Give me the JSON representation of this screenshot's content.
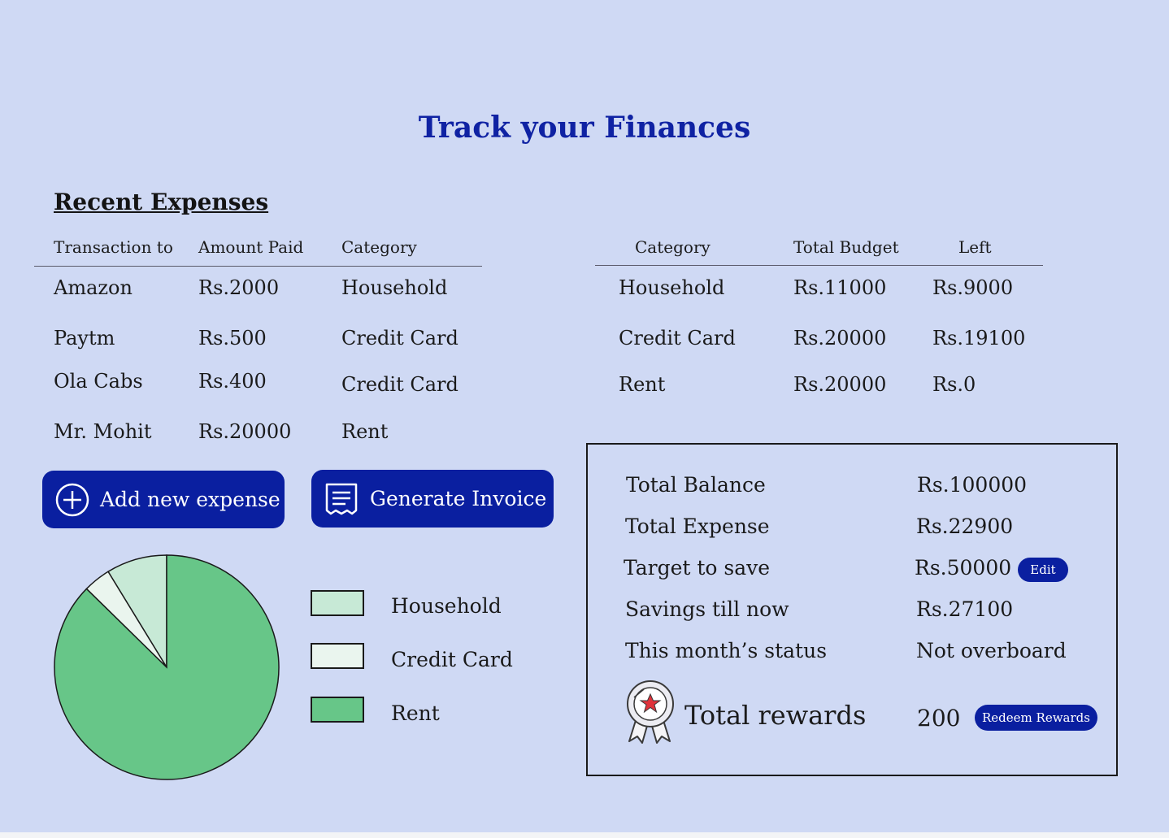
{
  "page_title": "Track your Finances",
  "recent_expenses": {
    "title": "Recent Expenses",
    "headers": [
      "Transaction to",
      "Amount Paid",
      "Category"
    ],
    "rows": [
      {
        "to": "Amazon",
        "amount": "Rs.2000",
        "category": "Household"
      },
      {
        "to": "Paytm",
        "amount": "Rs.500",
        "category": "Credit Card"
      },
      {
        "to": "Ola Cabs",
        "amount": "Rs.400",
        "category": "Credit Card"
      },
      {
        "to": "Mr. Mohit",
        "amount": "Rs.20000",
        "category": "Rent"
      }
    ]
  },
  "budget": {
    "headers": [
      "Category",
      "Total Budget",
      "Left"
    ],
    "rows": [
      {
        "category": "Household",
        "total": "Rs.11000",
        "left": "Rs.9000"
      },
      {
        "category": "Credit Card",
        "total": "Rs.20000",
        "left": "Rs.19100"
      },
      {
        "category": "Rent",
        "total": "Rs.20000",
        "left": "Rs.0"
      }
    ]
  },
  "actions": {
    "add_expense": "Add new expense",
    "generate_invoice": "Generate Invoice"
  },
  "summary": {
    "total_balance_label": "Total Balance",
    "total_balance_value": "Rs.100000",
    "total_expense_label": "Total Expense",
    "total_expense_value": "Rs.22900",
    "target_label": "Target to save",
    "target_value": "Rs.50000",
    "edit_label": "Edit",
    "savings_label": "Savings till now",
    "savings_value": "Rs.27100",
    "status_label": "This month’s status",
    "status_value": "Not overboard",
    "rewards_label": "Total rewards",
    "rewards_value": "200",
    "redeem_label": "Redeem Rewards"
  },
  "colors": {
    "background": "#cfd9f4",
    "accent": "#0a1fa0",
    "title": "#0f22a3",
    "household": "#c7e9d6",
    "credit_card": "#eaf5ee",
    "rent": "#67c688"
  },
  "chart_data": {
    "type": "pie",
    "slices": [
      {
        "label": "Household",
        "value": 2000,
        "color": "#c7e9d6"
      },
      {
        "label": "Credit Card",
        "value": 900,
        "color": "#eaf5ee"
      },
      {
        "label": "Rent",
        "value": 20000,
        "color": "#67c688"
      }
    ],
    "legend": [
      "Household",
      "Credit Card",
      "Rent"
    ],
    "legend_placement": "right"
  }
}
